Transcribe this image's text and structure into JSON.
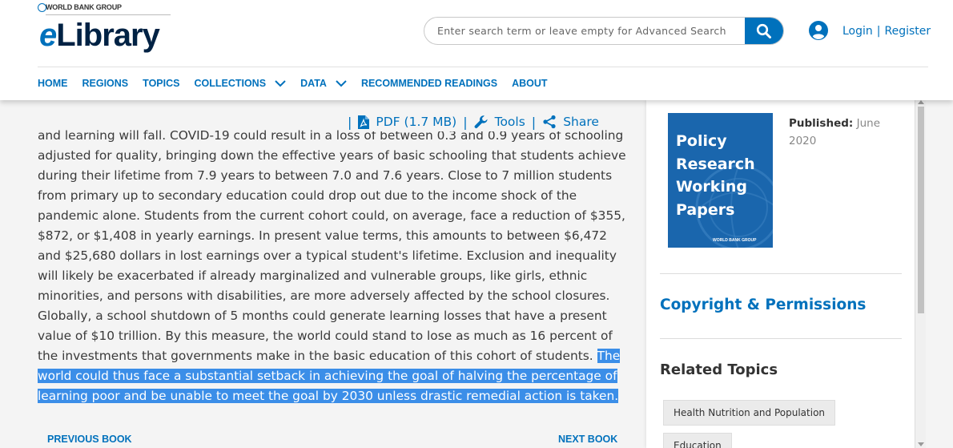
{
  "header": {
    "logo_org": "WORLD BANK GROUP",
    "logo_e": "e",
    "logo_name": "Library",
    "search_placeholder": "Enter search term or leave empty for Advanced Search",
    "search_icon": "search-icon",
    "user_icon": "user-circle-icon",
    "login_label": "Login",
    "separator": "|",
    "register_label": "Register"
  },
  "nav": {
    "items": [
      {
        "label": "HOME"
      },
      {
        "label": "REGIONS"
      },
      {
        "label": "TOPICS"
      },
      {
        "label": "COLLECTIONS",
        "icon": "chevron-down-icon"
      },
      {
        "label": "DATA",
        "icon": "chevron-down-icon"
      },
      {
        "label": "RECOMMENDED READINGS"
      },
      {
        "label": "ABOUT"
      }
    ]
  },
  "toolbar": {
    "separator": "|",
    "pdf_label": "PDF",
    "pdf_size": "(1.7 MB)",
    "tools_label": "Tools",
    "share_label": "Share"
  },
  "abstract": {
    "cut_line": "and learning will fall. COVID-19 could result in a loss of between 0.3 and 0.9 years of schooling",
    "body": "adjusted for quality, bringing down the effective years of basic schooling that students achieve during their lifetime from 7.9 years to between 7.0 and 7.6 years. Close to 7 million students from primary up to secondary education could drop out due to the income shock of the pandemic alone. Students from the current cohort could, on average, face a reduction of $355, $872, or $1,408 in yearly earnings. In present value terms, this amounts to between $6,472 and $25,680 dollars in lost earnings over a typical student's lifetime. Exclusion and inequality will likely be exacerbated if already marginalized and vulnerable groups, like girls, ethnic minorities, and persons with disabilities, are more adversely affected by the school closures. Globally, a school shutdown of 5 months could generate learning losses that have a present value of $10 trillion. By this measure, the world could stand to lose as much as 16 percent of the investments that governments make in the basic education of this cohort of students. ",
    "highlighted": "The world could thus face a substantial setback in achieving the goal of halving the percentage of learning poor and be unable to meet the goal by 2030 unless drastic remedial action is taken."
  },
  "pager": {
    "previous_label": "PREVIOUS BOOK",
    "next_label": "NEXT BOOK"
  },
  "sidebar": {
    "cover_title": "Policy\nResearch\nWorking\nPapers",
    "cover_publisher": "WORLD BANK GROUP",
    "published_label": "Published:",
    "published_value": "June 2020",
    "copyright_label": "Copyright & Permissions",
    "related_title": "Related Topics",
    "related_topics": [
      "Health Nutrition and Population",
      "Education"
    ]
  },
  "colors": {
    "accent": "#0071bc",
    "brand_navy": "#002244",
    "highlight": "#3b8ee8",
    "cover_blue": "#1a66ad"
  }
}
